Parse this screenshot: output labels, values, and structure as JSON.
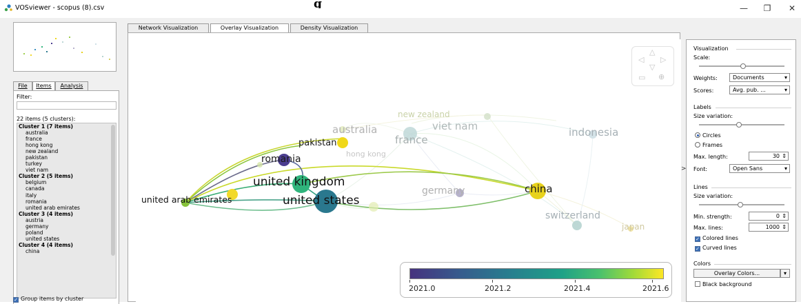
{
  "window": {
    "title": "VOSviewer - scopus (8).csv",
    "heading": "g",
    "controls": {
      "minimize": "—",
      "maximize": "❐",
      "close": "✕"
    }
  },
  "left_panel": {
    "tabs": [
      {
        "label": "File",
        "active": false
      },
      {
        "label": "Items",
        "active": true
      },
      {
        "label": "Analysis",
        "active": false
      }
    ],
    "filter_label": "Filter:",
    "filter_value": "",
    "items_count_label": "22 items (5 clusters):",
    "list": [
      {
        "kind": "cluster",
        "text": "Cluster 1 (7 items)"
      },
      {
        "kind": "item",
        "text": "australia"
      },
      {
        "kind": "item",
        "text": "france"
      },
      {
        "kind": "item",
        "text": "hong kong"
      },
      {
        "kind": "item",
        "text": "new zealand"
      },
      {
        "kind": "item",
        "text": "pakistan"
      },
      {
        "kind": "item",
        "text": "turkey"
      },
      {
        "kind": "item",
        "text": "viet nam"
      },
      {
        "kind": "cluster",
        "text": "Cluster 2 (5 items)"
      },
      {
        "kind": "item",
        "text": "belgium"
      },
      {
        "kind": "item",
        "text": "canada"
      },
      {
        "kind": "item",
        "text": "italy"
      },
      {
        "kind": "item",
        "text": "romania"
      },
      {
        "kind": "item",
        "text": "united arab emirates"
      },
      {
        "kind": "cluster",
        "text": "Cluster 3 (4 items)"
      },
      {
        "kind": "item",
        "text": "austria"
      },
      {
        "kind": "item",
        "text": "germany"
      },
      {
        "kind": "item",
        "text": "poland"
      },
      {
        "kind": "item",
        "text": "united states"
      },
      {
        "kind": "cluster",
        "text": "Cluster 4 (4 items)"
      },
      {
        "kind": "item",
        "text": "china"
      },
      {
        "kind": "item",
        "text": ""
      }
    ],
    "group_items_label": "Group items by cluster",
    "group_items_checked": true
  },
  "view_tabs": [
    {
      "label": "Network Visualization",
      "active": false
    },
    {
      "label": "Overlay Visualization",
      "active": true
    },
    {
      "label": "Density Visualization",
      "active": false
    }
  ],
  "network": {
    "labels": [
      {
        "text": "new zealand",
        "color": "#c9d2a8"
      },
      {
        "text": "australia",
        "color": "#b3b3b3"
      },
      {
        "text": "viet nam",
        "color": "#b0b8b8"
      },
      {
        "text": "indonesia",
        "color": "#a6b0b5"
      },
      {
        "text": "pakistan",
        "color": "#1a1a1a"
      },
      {
        "text": "france",
        "color": "#a8b0b0"
      },
      {
        "text": "hong kong",
        "color": "#c6c6c6"
      },
      {
        "text": "romania",
        "color": "#1a1a1a"
      },
      {
        "text": "united kingdom",
        "color": "#111111"
      },
      {
        "text": "germany",
        "color": "#b0b0b0"
      },
      {
        "text": "china",
        "color": "#1a1a1a"
      },
      {
        "text": "united arab emirates",
        "color": "#111111"
      },
      {
        "text": "united states",
        "color": "#111111"
      },
      {
        "text": "switzerland",
        "color": "#a6b0b5"
      },
      {
        "text": "japan",
        "color": "#d0c9a0"
      }
    ],
    "node_colors": {
      "united_states": "#2a788e",
      "united_kingdom": "#2fb47c",
      "china": "#e8d21c",
      "pakistan": "#f0d818",
      "romania": "#4b3d8f",
      "uae": "#86c23a",
      "uae_top": "#f2d92a",
      "germany": "#b7b2cc",
      "france": "#bcd6d6",
      "indonesia": "#cfe0e6",
      "switzerland": "#b6d4d0"
    }
  },
  "colorbar": {
    "ticks": [
      "2021.0",
      "2021.2",
      "2021.4",
      "2021.6"
    ],
    "scale_colors": [
      "#46327e",
      "#365c8d",
      "#277f8e",
      "#1fa187",
      "#4ac16d",
      "#a0da39",
      "#fde725"
    ]
  },
  "right_panel": {
    "visualization_title": "Visualization",
    "scale_label": "Scale:",
    "weights_label": "Weights:",
    "weights_value": "Documents",
    "scores_label": "Scores:",
    "scores_value": "Avg. pub. ...",
    "labels_title": "Labels",
    "size_variation_label": "Size variation:",
    "circles_label": "Circles",
    "frames_label": "Frames",
    "label_shape_selected": "Circles",
    "max_length_label": "Max. length:",
    "max_length_value": "30",
    "font_label": "Font:",
    "font_value": "Open Sans",
    "lines_title": "Lines",
    "lines_size_variation_label": "Size variation:",
    "min_strength_label": "Min. strength:",
    "min_strength_value": "0",
    "max_lines_label": "Max. lines:",
    "max_lines_value": "1000",
    "colored_lines_label": "Colored lines",
    "colored_lines_checked": true,
    "curved_lines_label": "Curved lines",
    "curved_lines_checked": true,
    "colors_title": "Colors",
    "overlay_colors_button": "Overlay Colors...",
    "black_background_label": "Black background",
    "black_background_checked": false,
    "expander": ">"
  }
}
